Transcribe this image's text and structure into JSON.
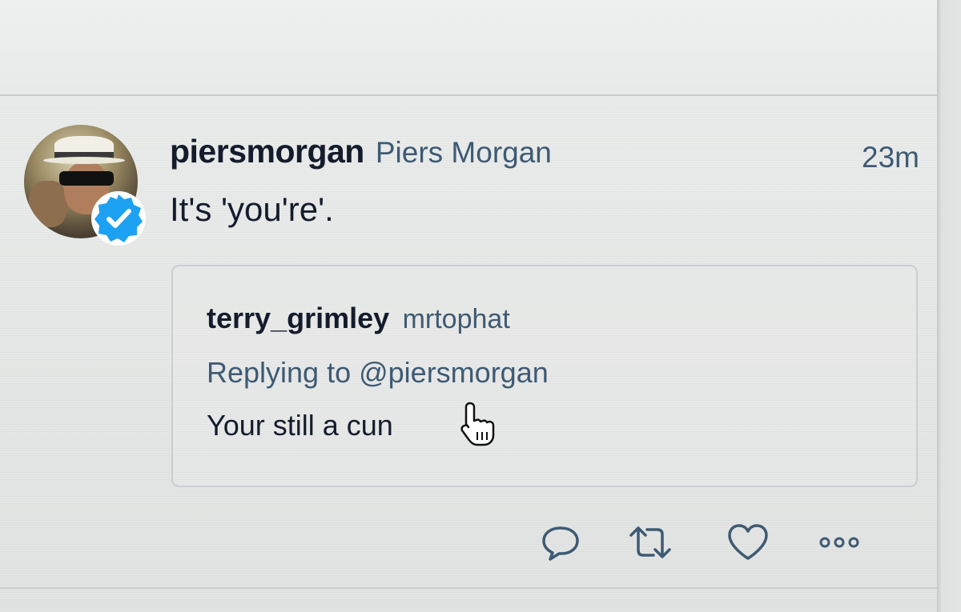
{
  "tweet": {
    "username": "piersmorgan",
    "display_name": "Piers Morgan",
    "time": "23m",
    "text": "It's 'you're'.",
    "avatar_icon": "avatar-photo",
    "verified_icon": "verified-badge-icon",
    "accent_color": "#1da1f2"
  },
  "quote": {
    "username": "terry_grimley",
    "display_name": "mrtophat",
    "replying_to": "Replying to @piersmorgan",
    "text": "Your still a cun"
  },
  "actions": {
    "reply_icon": "reply-icon",
    "retweet_icon": "retweet-icon",
    "like_icon": "heart-icon",
    "more_icon": "more-icon"
  },
  "cursor_icon": "hand-pointer-icon"
}
